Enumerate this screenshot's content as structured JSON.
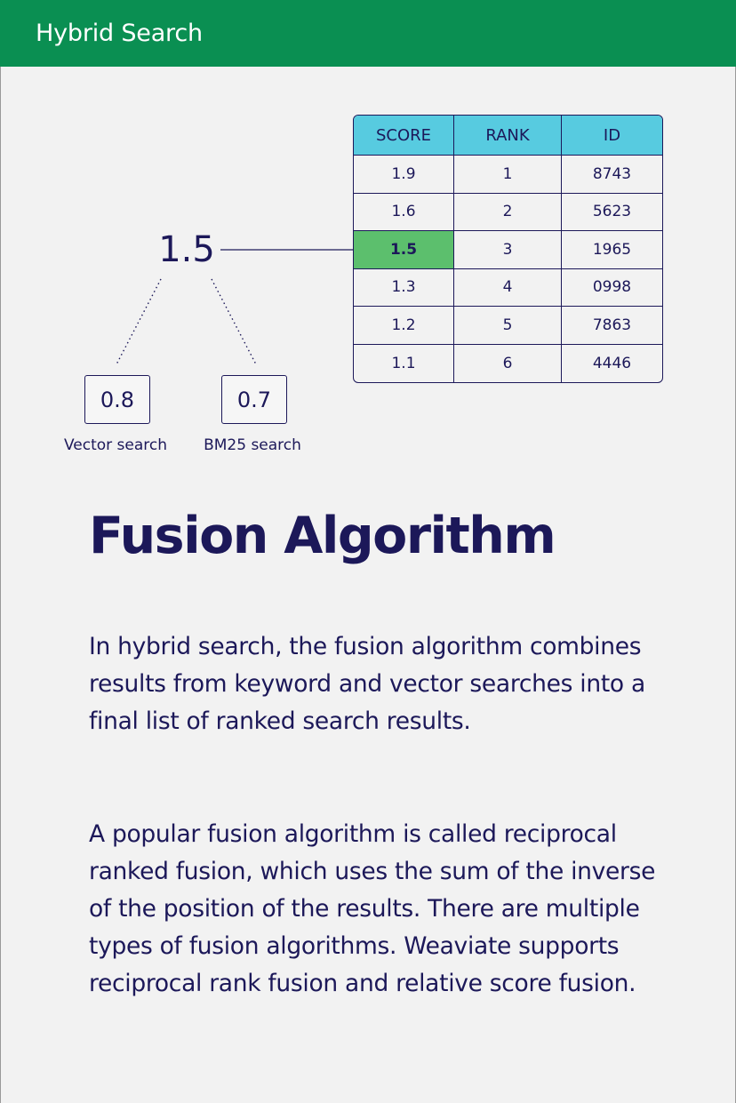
{
  "header": {
    "title": "Hybrid Search"
  },
  "diagram": {
    "combined_score": "1.5",
    "vector": {
      "score": "0.8",
      "label": "Vector search"
    },
    "bm25": {
      "score": "0.7",
      "label": "BM25 search"
    },
    "highlight_row_index": 2,
    "highlight_color": "#5cbf6d",
    "header_color": "#57cbe0"
  },
  "table": {
    "headers": [
      "SCORE",
      "RANK",
      "ID"
    ],
    "rows": [
      [
        "1.9",
        "1",
        "8743"
      ],
      [
        "1.6",
        "2",
        "5623"
      ],
      [
        "1.5",
        "3",
        "1965"
      ],
      [
        "1.3",
        "4",
        "0998"
      ],
      [
        "1.2",
        "5",
        "7863"
      ],
      [
        "1.1",
        "6",
        "4446"
      ]
    ]
  },
  "content": {
    "title": "Fusion Algorithm",
    "paragraph1": "In hybrid search, the fusion algorithm combines results from keyword and vector searches into a final list of ranked search results.",
    "paragraph2": "A popular fusion algorithm is called reciprocal ranked fusion, which uses the sum of the inverse of the position of the results. There are multiple types of fusion algorithms. Weaviate supports reciprocal rank fusion and relative score fusion."
  },
  "colors": {
    "brand_green": "#0a8f52",
    "text_navy": "#1c1859",
    "background": "#f2f2f2"
  }
}
